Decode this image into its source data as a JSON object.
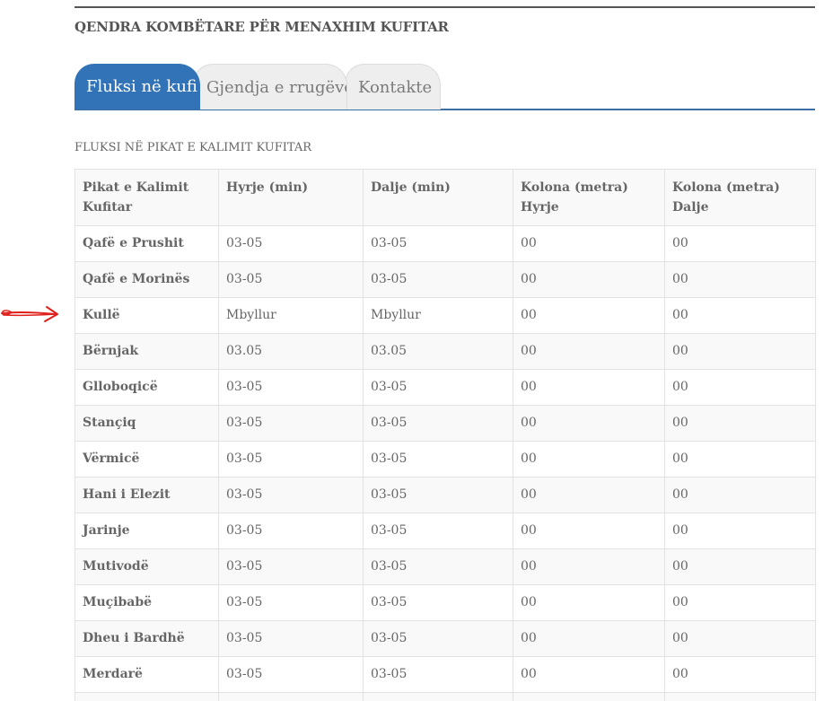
{
  "header": {
    "site_title": "QENDRA KOMBËTARE PËR MENAXHIM KUFITAR"
  },
  "tabs": [
    {
      "label": "Fluksi në kufi",
      "active": true
    },
    {
      "label": "Gjendja e rrugëve",
      "active": false
    },
    {
      "label": "Kontakte",
      "active": false
    }
  ],
  "section": {
    "title": "FLUKSI NË PIKAT E KALIMIT KUFITAR"
  },
  "table": {
    "headers": [
      "Pikat e Kalimit Kufitar",
      "Hyrje (min)",
      "Dalje (min)",
      "Kolona (metra) Hyrje",
      "Kolona (metra) Dalje"
    ],
    "rows": [
      [
        "Qafë e Prushit",
        "03-05",
        "03-05",
        "00",
        "00"
      ],
      [
        "Qafë e Morinës",
        "03-05",
        "03-05",
        "00",
        "00"
      ],
      [
        "Kullë",
        "Mbyllur",
        "Mbyllur",
        "00",
        "00"
      ],
      [
        "Bërnjak",
        "03.05",
        "03.05",
        "00",
        "00"
      ],
      [
        "Glloboqicë",
        "03-05",
        "03-05",
        "00",
        "00"
      ],
      [
        "Stançiq",
        "03-05",
        "03-05",
        "00",
        "00"
      ],
      [
        "Vërmicë",
        "03-05",
        "03-05",
        "00",
        "00"
      ],
      [
        "Hani i Elezit",
        "03-05",
        "03-05",
        "00",
        "00"
      ],
      [
        "Jarinje",
        "03-05",
        "03-05",
        "00",
        "00"
      ],
      [
        "Mutivodë",
        "03-05",
        "03-05",
        "00",
        "00"
      ],
      [
        "Muçibabë",
        "03-05",
        "03-05",
        "00",
        "00"
      ],
      [
        "Dheu i Bardhë",
        "03-05",
        "03-05",
        "00",
        "00"
      ],
      [
        "Merdarë",
        "03-05",
        "03-05",
        "00",
        "00"
      ],
      [
        "",
        "",
        "",
        "",
        ""
      ]
    ]
  },
  "annotation": {
    "icon": "red-arrow-icon",
    "color": "#e0201c",
    "points_to_row": "Kullë"
  },
  "colors": {
    "accent": "#3273b8",
    "text": "#555555"
  }
}
